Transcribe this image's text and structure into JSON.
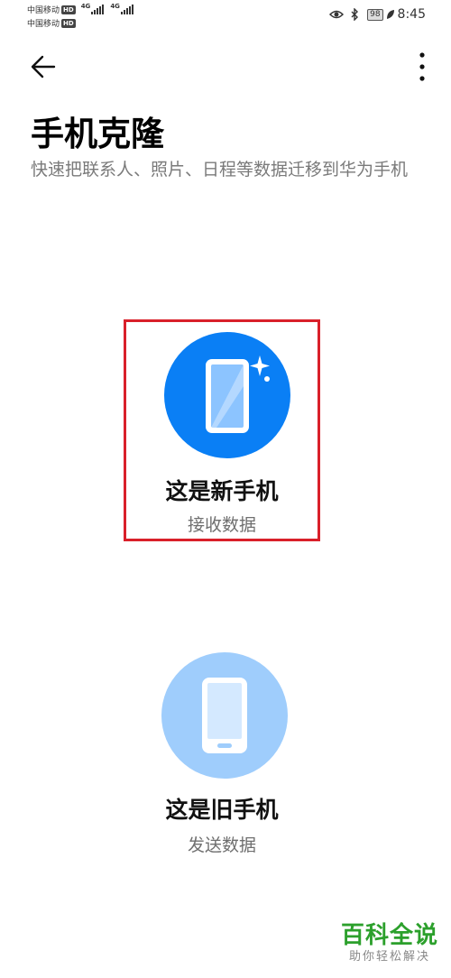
{
  "status_bar": {
    "carriers": [
      {
        "name": "中国移动",
        "badge": "HD",
        "network": "4G"
      },
      {
        "name": "中国移动",
        "badge": "HD",
        "network": "4G"
      }
    ],
    "battery": "98",
    "time": "8:45",
    "icons": [
      "eye-comfort-icon",
      "bluetooth-icon",
      "battery-icon",
      "leaf-icon"
    ]
  },
  "app_bar": {
    "back_icon": "arrow-left-icon",
    "menu_icon": "more-vertical-icon"
  },
  "page": {
    "title": "手机克隆",
    "subtitle": "快速把联系人、照片、日程等数据迁移到华为手机"
  },
  "options": [
    {
      "label": "这是新手机",
      "sublabel": "接收数据",
      "icon": "new-phone-icon",
      "color": "#0a7ff5",
      "selected": true
    },
    {
      "label": "这是旧手机",
      "sublabel": "发送数据",
      "icon": "old-phone-icon",
      "color": "#9fcdfc",
      "selected": false
    }
  ],
  "colors": {
    "highlight_border": "#d9202a",
    "watermark_green": "#2ca02c"
  },
  "watermark": {
    "main": "百科全说",
    "sub": "助你轻松解决"
  }
}
